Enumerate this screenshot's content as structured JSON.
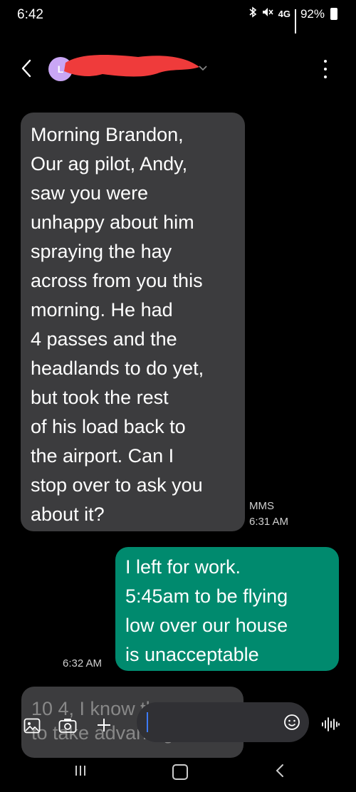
{
  "status_bar": {
    "time": "6:42",
    "network": "4G",
    "battery": "92%"
  },
  "header": {
    "avatar_letter": "L",
    "redaction_color": "#ef3b3b"
  },
  "messages": [
    {
      "direction": "incoming",
      "text": "Morning Brandon,\nOur ag pilot, Andy,\nsaw you were\nunhappy about him\nspraying the hay\nacross from you this\nmorning. He had\n4 passes and the\nheadlands to do yet,\nbut took the rest\nof his load back to\nthe airport. Can I\nstop over to ask you\nabout it?",
      "type": "MMS",
      "time": "6:31 AM"
    },
    {
      "direction": "outgoing",
      "text": "I left for work.\n5:45am to be flying\nlow over our house\nis unacceptable",
      "time": "6:32 AM"
    },
    {
      "direction": "incoming",
      "text": "10 4, I know they try\nto take advantage"
    }
  ],
  "composer": {
    "placeholder": ""
  },
  "colors": {
    "incoming_bubble": "#3c3c3e",
    "outgoing_bubble": "#008a6e",
    "cursor": "#3d7bff"
  }
}
